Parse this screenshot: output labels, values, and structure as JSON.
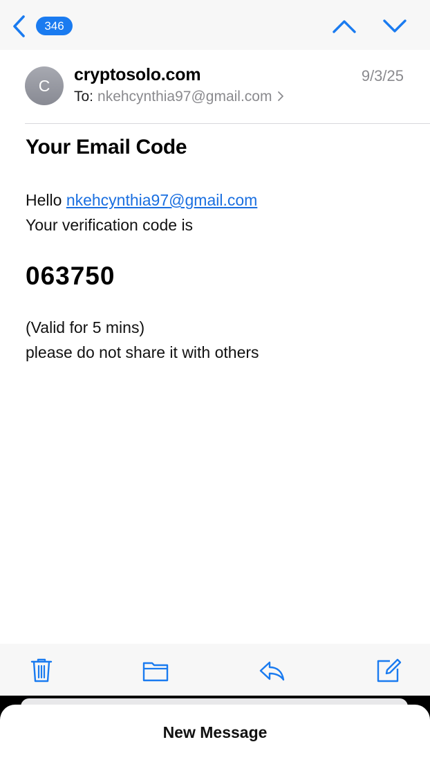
{
  "nav": {
    "unread_count": "346",
    "back_icon": "chevron-left-icon",
    "prev_icon": "chevron-up-icon",
    "next_icon": "chevron-down-icon",
    "accent_color": "#1a7bf0"
  },
  "message": {
    "avatar_initial": "C",
    "sender": "cryptosolo.com",
    "date": "9/3/25",
    "to_label": "To:",
    "to_address": "nkehcynthia97@gmail.com",
    "subject": "Your Email Code",
    "greeting": "Hello",
    "greeting_email": "nkehcynthia97@gmail.com",
    "intro": "Your verification code is",
    "code": "063750",
    "validity": "(Valid for 5 mins)",
    "warning": "please do not share it with others"
  },
  "toolbar": {
    "items": [
      {
        "name": "trash-icon"
      },
      {
        "name": "folder-icon"
      },
      {
        "name": "reply-icon"
      },
      {
        "name": "compose-icon"
      }
    ]
  },
  "compose_sheet": {
    "title": "New Message"
  }
}
